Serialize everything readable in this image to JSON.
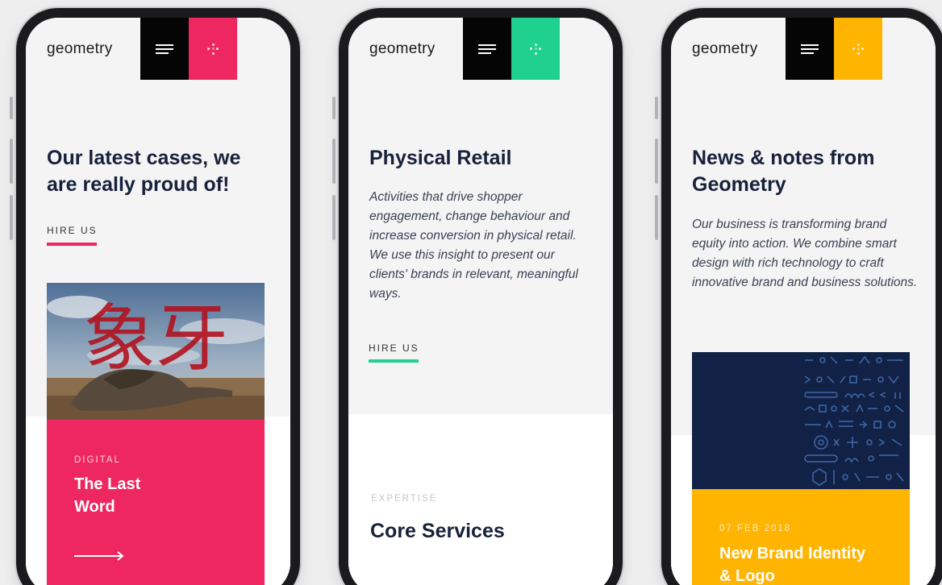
{
  "brand": {
    "logo": "geometry"
  },
  "icons": {
    "menu": "hamburger-menu-icon",
    "grid": "dot-grid-icon",
    "arrow": "arrow-right-icon"
  },
  "phones": [
    {
      "accent": "#ef2760",
      "headline": "Our latest cases, we are really proud of!",
      "cta": "HIRE US",
      "card": {
        "category": "DIGITAL",
        "title": "The Last Word",
        "image_text": "象牙"
      }
    },
    {
      "accent": "#1fd08f",
      "headline": "Physical Retail",
      "body": "Activities that drive shopper engagement, change behaviour and increase conversion in physical retail. We use this insight to present our clients' brands in relevant, meaningful ways.",
      "cta": "HIRE US",
      "section": {
        "eyebrow": "EXPERTISE",
        "title": "Core Services"
      }
    },
    {
      "accent": "#ffb400",
      "headline": "News & notes from Geometry",
      "body": "Our business is transforming brand equity into action. We combine smart design with rich technology to craft innovative brand and business solutions.",
      "card": {
        "date": "07 FEB 2018",
        "title": "New Brand Identity & Logo"
      }
    }
  ]
}
